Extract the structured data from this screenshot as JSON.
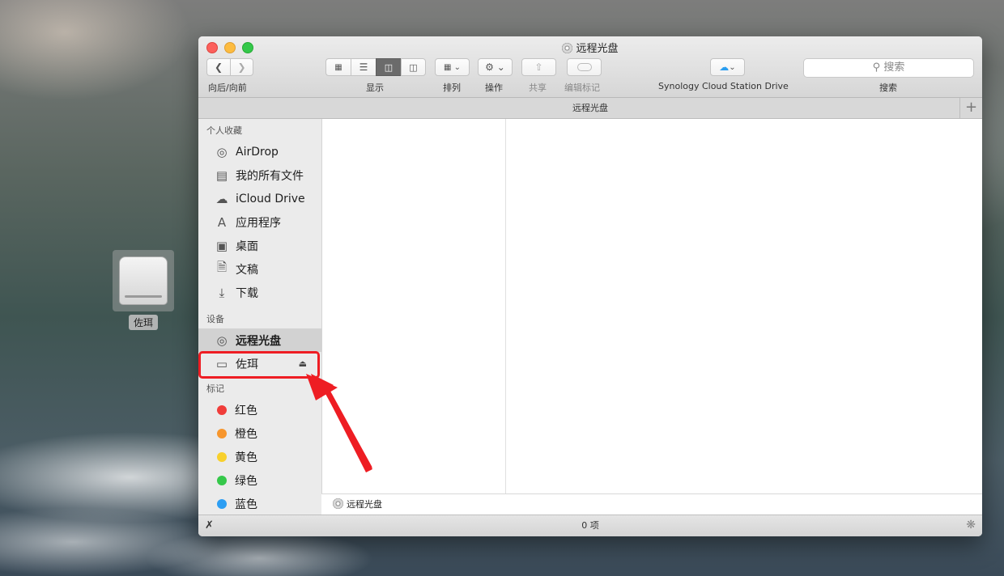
{
  "desktop": {
    "drive_label": "佐珥"
  },
  "window": {
    "title": "远程光盘",
    "toolbar": {
      "nav_label": "向后/向前",
      "view_label": "显示",
      "arrange_label": "排列",
      "action_label": "操作",
      "share_label": "共享",
      "tags_label": "编辑标记",
      "cloud_label": "Synology Cloud Station Drive",
      "search_label": "搜索",
      "search_placeholder": "搜索"
    },
    "tab_title": "远程光盘",
    "sidebar": {
      "favorites_header": "个人收藏",
      "favorites": [
        {
          "label": "AirDrop",
          "icon": "airdrop-icon"
        },
        {
          "label": "我的所有文件",
          "icon": "all-files-icon"
        },
        {
          "label": "iCloud Drive",
          "icon": "cloud-icon"
        },
        {
          "label": "应用程序",
          "icon": "applications-icon"
        },
        {
          "label": "桌面",
          "icon": "desktop-icon"
        },
        {
          "label": "文稿",
          "icon": "documents-icon"
        },
        {
          "label": "下载",
          "icon": "downloads-icon"
        }
      ],
      "devices_header": "设备",
      "devices": [
        {
          "label": "远程光盘",
          "icon": "disc-icon"
        },
        {
          "label": "佐珥",
          "icon": "drive-icon"
        }
      ],
      "tags_header": "标记",
      "tags": [
        {
          "label": "红色",
          "color": "#f03d3a"
        },
        {
          "label": "橙色",
          "color": "#f7962d"
        },
        {
          "label": "黄色",
          "color": "#f8d02c"
        },
        {
          "label": "绿色",
          "color": "#35c84a"
        },
        {
          "label": "蓝色",
          "color": "#2d9ef3"
        }
      ]
    },
    "pathbar": {
      "item": "远程光盘"
    },
    "status": {
      "count": "0 项"
    },
    "annotation_color": "#ee1d23"
  }
}
